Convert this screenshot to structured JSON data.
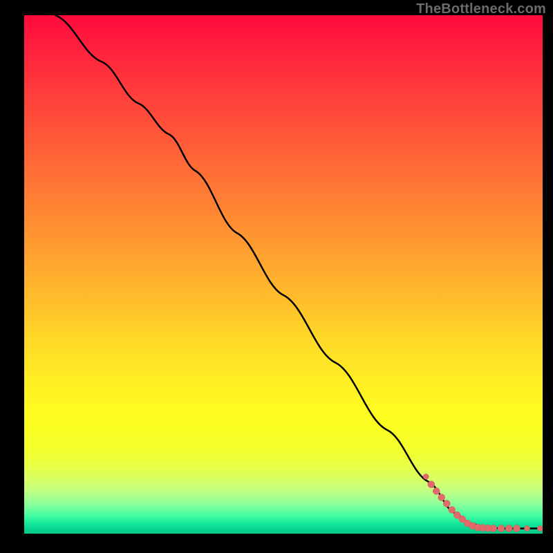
{
  "watermark": "TheBottleneck.com",
  "colors": {
    "point_fill": "#e26a6a",
    "point_stroke": "#d85a5a",
    "curve": "#000000"
  },
  "chart_data": {
    "type": "line",
    "title": "",
    "xlabel": "",
    "ylabel": "",
    "xlim": [
      0,
      100
    ],
    "ylim": [
      0,
      100
    ],
    "curve": [
      {
        "x": 6,
        "y": 100
      },
      {
        "x": 15,
        "y": 91
      },
      {
        "x": 22,
        "y": 83
      },
      {
        "x": 28,
        "y": 77
      },
      {
        "x": 33,
        "y": 70
      },
      {
        "x": 41,
        "y": 58
      },
      {
        "x": 50,
        "y": 46
      },
      {
        "x": 60,
        "y": 33
      },
      {
        "x": 70,
        "y": 20
      },
      {
        "x": 78,
        "y": 10
      },
      {
        "x": 83,
        "y": 4
      },
      {
        "x": 86,
        "y": 2
      },
      {
        "x": 89,
        "y": 1.2
      },
      {
        "x": 92,
        "y": 1.0
      },
      {
        "x": 96,
        "y": 1.0
      },
      {
        "x": 100,
        "y": 1.0
      }
    ],
    "points": [
      {
        "x": 77.5,
        "y": 11.0,
        "r": 4
      },
      {
        "x": 78.5,
        "y": 9.5,
        "r": 5
      },
      {
        "x": 79.5,
        "y": 8.2,
        "r": 5
      },
      {
        "x": 80.5,
        "y": 7.0,
        "r": 5
      },
      {
        "x": 81.5,
        "y": 5.8,
        "r": 5
      },
      {
        "x": 82.5,
        "y": 4.6,
        "r": 5
      },
      {
        "x": 83.5,
        "y": 3.6,
        "r": 5
      },
      {
        "x": 84.5,
        "y": 2.8,
        "r": 5
      },
      {
        "x": 85.5,
        "y": 2.0,
        "r": 5
      },
      {
        "x": 86.5,
        "y": 1.5,
        "r": 5
      },
      {
        "x": 87.5,
        "y": 1.2,
        "r": 5
      },
      {
        "x": 88.5,
        "y": 1.1,
        "r": 5
      },
      {
        "x": 89.5,
        "y": 1.05,
        "r": 5
      },
      {
        "x": 90.5,
        "y": 1.0,
        "r": 5
      },
      {
        "x": 92.0,
        "y": 1.0,
        "r": 5
      },
      {
        "x": 93.5,
        "y": 1.0,
        "r": 5
      },
      {
        "x": 95.0,
        "y": 1.0,
        "r": 5
      },
      {
        "x": 97.0,
        "y": 1.0,
        "r": 4
      },
      {
        "x": 99.5,
        "y": 1.0,
        "r": 4
      }
    ]
  }
}
